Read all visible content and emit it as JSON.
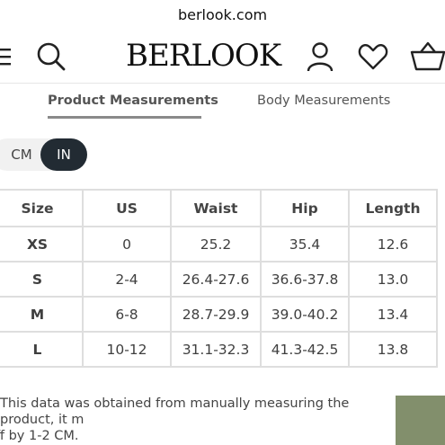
{
  "browser": {
    "url": "berlook.com"
  },
  "header": {
    "logo": "BERLOOK",
    "icons": [
      "menu-icon",
      "search-icon",
      "account-icon",
      "heart-icon",
      "cart-icon"
    ]
  },
  "tabs": [
    {
      "label": "Product Measurements",
      "active": true
    },
    {
      "label": "Body Measurements",
      "active": false
    }
  ],
  "unit_toggle": {
    "options": [
      "CM",
      "IN"
    ],
    "selected": "IN",
    "active_color": "#222b33"
  },
  "size_table": {
    "columns": [
      "Size",
      "US",
      "Waist",
      "Hip",
      "Length"
    ],
    "rows": [
      [
        "XS",
        "0",
        "25.2",
        "35.4",
        "12.6"
      ],
      [
        "S",
        "2-4",
        "26.4-27.6",
        "36.6-37.8",
        "13.0"
      ],
      [
        "M",
        "6-8",
        "28.7-29.9",
        "39.0-40.2",
        "13.4"
      ],
      [
        "L",
        "10-12",
        "31.1-32.3",
        "41.3-42.5",
        "13.8"
      ]
    ]
  },
  "note": {
    "line1": "This data was obtained from manually measuring the product, it m",
    "line2": "ff by 1-2 CM."
  },
  "swatch_color": "#828f6c"
}
